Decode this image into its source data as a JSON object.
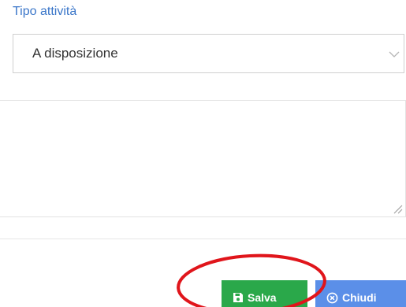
{
  "form": {
    "activity_type_label": "Tipo attività",
    "activity_type_value": "A disposizione",
    "notes_value": ""
  },
  "actions": {
    "save_label": "Salva",
    "close_label": "Chiudi"
  },
  "icons": {
    "select_chevron": "chevron-down-icon",
    "resize": "resize-handle-icon",
    "save": "floppy-disk-icon",
    "close": "circle-x-icon"
  },
  "colors": {
    "label": "#3a76c9",
    "save_button": "#2aa84a",
    "close_button": "#5b8fe8",
    "annotation": "#e0151b"
  }
}
